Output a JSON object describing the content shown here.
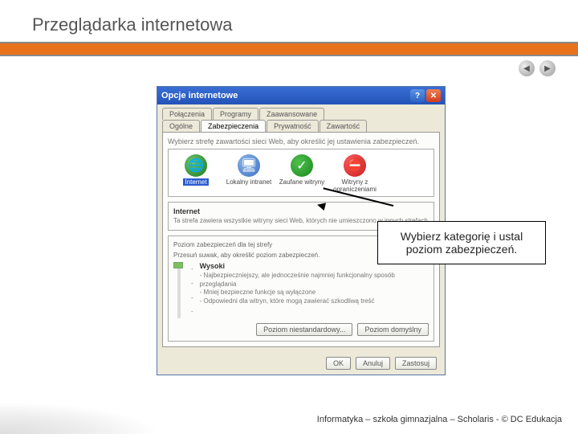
{
  "slide": {
    "title": "Przeglądarka internetowa"
  },
  "dialog": {
    "title": "Opcje internetowe",
    "tabs_row1": [
      "Połączenia",
      "Programy",
      "Zaawansowane"
    ],
    "tabs_row2": [
      "Ogólne",
      "Zabezpieczenia",
      "Prywatność",
      "Zawartość"
    ],
    "active_tab": "Zabezpieczenia",
    "instruction": "Wybierz strefę zawartości sieci Web, aby określić jej ustawienia zabezpieczeń.",
    "zones": [
      {
        "label": "Internet",
        "key": "internet",
        "glyph": "🌐",
        "selected": true
      },
      {
        "label": "Lokalny intranet",
        "key": "local",
        "glyph": "🖥",
        "selected": false
      },
      {
        "label": "Zaufane witryny",
        "key": "trusted",
        "glyph": "✓",
        "selected": false
      },
      {
        "label": "Witryny z ograniczeniami",
        "key": "restricted",
        "glyph": "⛔",
        "selected": false
      }
    ],
    "zone_detail": {
      "heading": "Internet",
      "description": "Ta strefa zawiera wszystkie witryny sieci Web, których nie umieszczono w innych strefach"
    },
    "security": {
      "caption": "Poziom zabezpieczeń dla tej strefy",
      "hint": "Przesuń suwak, aby określić poziom zabezpieczeń.",
      "level_name": "Wysoki",
      "bullets": [
        "- Najbezpieczniejszy, ale jednocześnie najmniej funkcjonalny sposób przeglądania",
        "- Mniej bezpieczne funkcje są wyłączone",
        "- Odpowiedni dla witryn, które mogą zawierać szkodliwą treść"
      ],
      "btn_custom": "Poziom niestandardowy...",
      "btn_default": "Poziom domyślny"
    },
    "buttons": {
      "ok": "OK",
      "cancel": "Anuluj",
      "apply": "Zastosuj"
    }
  },
  "callout": {
    "text": "Wybierz kategorię i ustal poziom zabezpieczeń."
  },
  "footer": {
    "text": "Informatyka – szkoła gimnazjalna – Scholaris - © DC Edukacja"
  }
}
